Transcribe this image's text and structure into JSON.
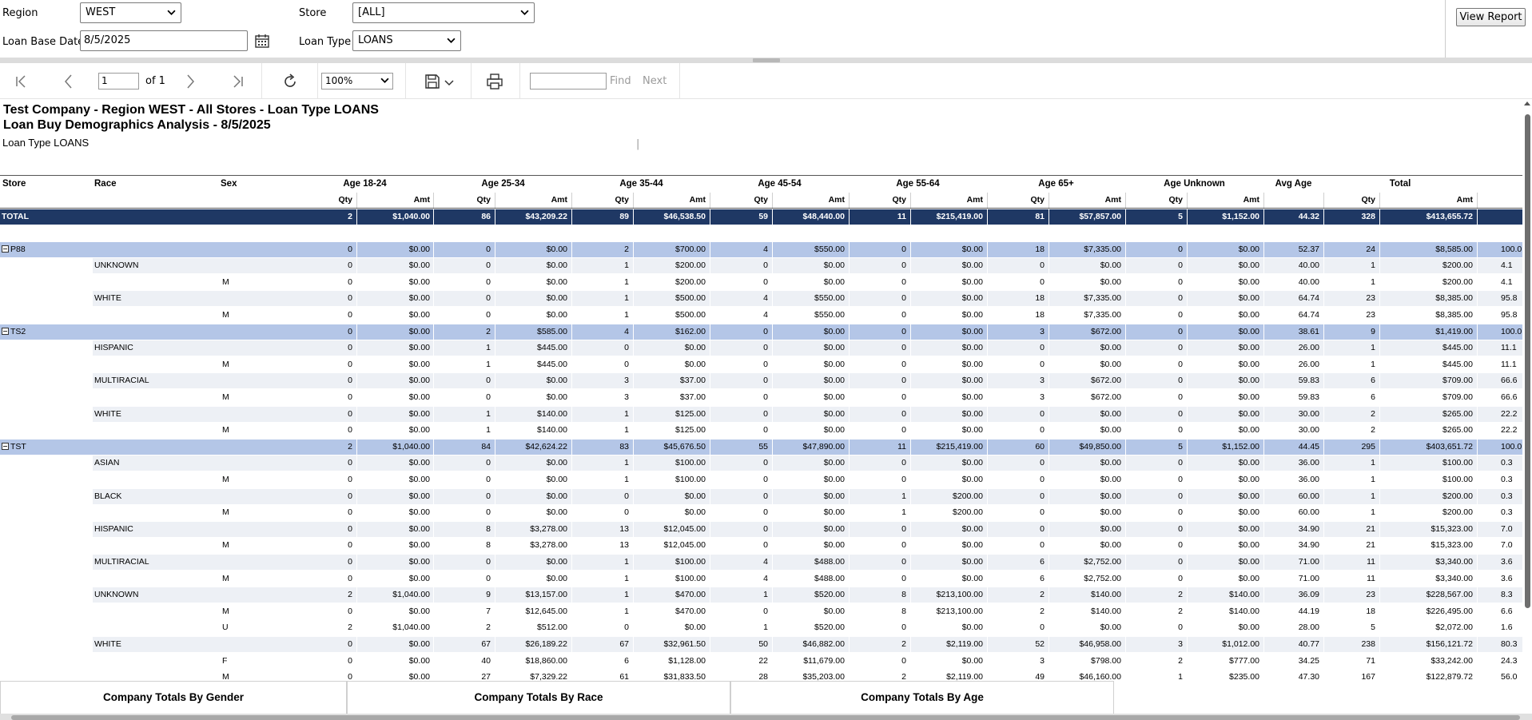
{
  "params": {
    "region_label": "Region",
    "region_value": "WEST",
    "store_label": "Store",
    "store_value": "[ALL]",
    "loan_base_date_label": "Loan Base Date",
    "loan_base_date_value": "8/5/2025",
    "loan_type_label": "Loan Type",
    "loan_type_value": "LOANS",
    "view_report_label": "View Report"
  },
  "toolbar": {
    "page_value": "1",
    "page_of": "of 1",
    "zoom_value": "100%",
    "find_placeholder": "",
    "find_label": "Find",
    "separator": "|",
    "next_label": "Next"
  },
  "report": {
    "title": "Test Company - Region WEST - All Stores - Loan Type LOANS",
    "subtitle": "Loan Buy Demographics Analysis - 8/5/2025",
    "loan_type_text": "Loan Type LOANS",
    "header1": [
      "Store",
      "Race",
      "Sex",
      "Age 18-24",
      "Age 25-34",
      "Age 35-44",
      "Age 45-54",
      "Age 55-64",
      "Age 65+",
      "Age Unknown",
      "Avg Age",
      "Total"
    ],
    "header2": [
      "Qty",
      "Amt",
      "Qty",
      "Amt",
      "Qty",
      "Amt",
      "Qty",
      "Amt",
      "Qty",
      "Amt",
      "Qty",
      "Amt",
      "Qty",
      "Amt",
      "Qty",
      "Amt"
    ],
    "rows": [
      {
        "kind": "total",
        "label": "TOTAL",
        "vals": [
          "2",
          "$1,040.00",
          "86",
          "$43,209.22",
          "89",
          "$46,538.50",
          "59",
          "$48,440.00",
          "11",
          "$215,419.00",
          "81",
          "$57,857.00",
          "5",
          "$1,152.00",
          "44.32",
          "328",
          "$413,655.72",
          ""
        ]
      },
      {
        "kind": "store",
        "label": "P88",
        "vals": [
          "0",
          "$0.00",
          "0",
          "$0.00",
          "2",
          "$700.00",
          "4",
          "$550.00",
          "0",
          "$0.00",
          "18",
          "$7,335.00",
          "0",
          "$0.00",
          "52.37",
          "24",
          "$8,585.00",
          "100.0"
        ]
      },
      {
        "kind": "race",
        "label": "UNKNOWN",
        "vals": [
          "0",
          "$0.00",
          "0",
          "$0.00",
          "1",
          "$200.00",
          "0",
          "$0.00",
          "0",
          "$0.00",
          "0",
          "$0.00",
          "0",
          "$0.00",
          "40.00",
          "1",
          "$200.00",
          "4.1"
        ]
      },
      {
        "kind": "sex",
        "label": "M",
        "vals": [
          "0",
          "$0.00",
          "0",
          "$0.00",
          "1",
          "$200.00",
          "0",
          "$0.00",
          "0",
          "$0.00",
          "0",
          "$0.00",
          "0",
          "$0.00",
          "40.00",
          "1",
          "$200.00",
          "4.1"
        ]
      },
      {
        "kind": "race",
        "label": "WHITE",
        "vals": [
          "0",
          "$0.00",
          "0",
          "$0.00",
          "1",
          "$500.00",
          "4",
          "$550.00",
          "0",
          "$0.00",
          "18",
          "$7,335.00",
          "0",
          "$0.00",
          "64.74",
          "23",
          "$8,385.00",
          "95.8"
        ]
      },
      {
        "kind": "sex",
        "label": "M",
        "vals": [
          "0",
          "$0.00",
          "0",
          "$0.00",
          "1",
          "$500.00",
          "4",
          "$550.00",
          "0",
          "$0.00",
          "18",
          "$7,335.00",
          "0",
          "$0.00",
          "64.74",
          "23",
          "$8,385.00",
          "95.8"
        ]
      },
      {
        "kind": "store",
        "label": "TS2",
        "vals": [
          "0",
          "$0.00",
          "2",
          "$585.00",
          "4",
          "$162.00",
          "0",
          "$0.00",
          "0",
          "$0.00",
          "3",
          "$672.00",
          "0",
          "$0.00",
          "38.61",
          "9",
          "$1,419.00",
          "100.0"
        ]
      },
      {
        "kind": "race",
        "label": "HISPANIC",
        "vals": [
          "0",
          "$0.00",
          "1",
          "$445.00",
          "0",
          "$0.00",
          "0",
          "$0.00",
          "0",
          "$0.00",
          "0",
          "$0.00",
          "0",
          "$0.00",
          "26.00",
          "1",
          "$445.00",
          "11.1"
        ]
      },
      {
        "kind": "sex",
        "label": "M",
        "vals": [
          "0",
          "$0.00",
          "1",
          "$445.00",
          "0",
          "$0.00",
          "0",
          "$0.00",
          "0",
          "$0.00",
          "0",
          "$0.00",
          "0",
          "$0.00",
          "26.00",
          "1",
          "$445.00",
          "11.1"
        ]
      },
      {
        "kind": "race",
        "label": "MULTIRACIAL",
        "vals": [
          "0",
          "$0.00",
          "0",
          "$0.00",
          "3",
          "$37.00",
          "0",
          "$0.00",
          "0",
          "$0.00",
          "3",
          "$672.00",
          "0",
          "$0.00",
          "59.83",
          "6",
          "$709.00",
          "66.6"
        ]
      },
      {
        "kind": "sex",
        "label": "M",
        "vals": [
          "0",
          "$0.00",
          "0",
          "$0.00",
          "3",
          "$37.00",
          "0",
          "$0.00",
          "0",
          "$0.00",
          "3",
          "$672.00",
          "0",
          "$0.00",
          "59.83",
          "6",
          "$709.00",
          "66.6"
        ]
      },
      {
        "kind": "race",
        "label": "WHITE",
        "vals": [
          "0",
          "$0.00",
          "1",
          "$140.00",
          "1",
          "$125.00",
          "0",
          "$0.00",
          "0",
          "$0.00",
          "0",
          "$0.00",
          "0",
          "$0.00",
          "30.00",
          "2",
          "$265.00",
          "22.2"
        ]
      },
      {
        "kind": "sex",
        "label": "M",
        "vals": [
          "0",
          "$0.00",
          "1",
          "$140.00",
          "1",
          "$125.00",
          "0",
          "$0.00",
          "0",
          "$0.00",
          "0",
          "$0.00",
          "0",
          "$0.00",
          "30.00",
          "2",
          "$265.00",
          "22.2"
        ]
      },
      {
        "kind": "store",
        "label": "TST",
        "vals": [
          "2",
          "$1,040.00",
          "84",
          "$42,624.22",
          "83",
          "$45,676.50",
          "55",
          "$47,890.00",
          "11",
          "$215,419.00",
          "60",
          "$49,850.00",
          "5",
          "$1,152.00",
          "44.45",
          "295",
          "$403,651.72",
          "100.0"
        ]
      },
      {
        "kind": "race",
        "label": "ASIAN",
        "vals": [
          "0",
          "$0.00",
          "0",
          "$0.00",
          "1",
          "$100.00",
          "0",
          "$0.00",
          "0",
          "$0.00",
          "0",
          "$0.00",
          "0",
          "$0.00",
          "36.00",
          "1",
          "$100.00",
          "0.3"
        ]
      },
      {
        "kind": "sex",
        "label": "M",
        "vals": [
          "0",
          "$0.00",
          "0",
          "$0.00",
          "1",
          "$100.00",
          "0",
          "$0.00",
          "0",
          "$0.00",
          "0",
          "$0.00",
          "0",
          "$0.00",
          "36.00",
          "1",
          "$100.00",
          "0.3"
        ]
      },
      {
        "kind": "race",
        "label": "BLACK",
        "vals": [
          "0",
          "$0.00",
          "0",
          "$0.00",
          "0",
          "$0.00",
          "0",
          "$0.00",
          "1",
          "$200.00",
          "0",
          "$0.00",
          "0",
          "$0.00",
          "60.00",
          "1",
          "$200.00",
          "0.3"
        ]
      },
      {
        "kind": "sex",
        "label": "M",
        "vals": [
          "0",
          "$0.00",
          "0",
          "$0.00",
          "0",
          "$0.00",
          "0",
          "$0.00",
          "1",
          "$200.00",
          "0",
          "$0.00",
          "0",
          "$0.00",
          "60.00",
          "1",
          "$200.00",
          "0.3"
        ]
      },
      {
        "kind": "race",
        "label": "HISPANIC",
        "vals": [
          "0",
          "$0.00",
          "8",
          "$3,278.00",
          "13",
          "$12,045.00",
          "0",
          "$0.00",
          "0",
          "$0.00",
          "0",
          "$0.00",
          "0",
          "$0.00",
          "34.90",
          "21",
          "$15,323.00",
          "7.0"
        ]
      },
      {
        "kind": "sex",
        "label": "M",
        "vals": [
          "0",
          "$0.00",
          "8",
          "$3,278.00",
          "13",
          "$12,045.00",
          "0",
          "$0.00",
          "0",
          "$0.00",
          "0",
          "$0.00",
          "0",
          "$0.00",
          "34.90",
          "21",
          "$15,323.00",
          "7.0"
        ]
      },
      {
        "kind": "race",
        "label": "MULTIRACIAL",
        "vals": [
          "0",
          "$0.00",
          "0",
          "$0.00",
          "1",
          "$100.00",
          "4",
          "$488.00",
          "0",
          "$0.00",
          "6",
          "$2,752.00",
          "0",
          "$0.00",
          "71.00",
          "11",
          "$3,340.00",
          "3.6"
        ]
      },
      {
        "kind": "sex",
        "label": "M",
        "vals": [
          "0",
          "$0.00",
          "0",
          "$0.00",
          "1",
          "$100.00",
          "4",
          "$488.00",
          "0",
          "$0.00",
          "6",
          "$2,752.00",
          "0",
          "$0.00",
          "71.00",
          "11",
          "$3,340.00",
          "3.6"
        ]
      },
      {
        "kind": "race",
        "label": "UNKNOWN",
        "vals": [
          "2",
          "$1,040.00",
          "9",
          "$13,157.00",
          "1",
          "$470.00",
          "1",
          "$520.00",
          "8",
          "$213,100.00",
          "2",
          "$140.00",
          "2",
          "$140.00",
          "36.09",
          "23",
          "$228,567.00",
          "8.3"
        ]
      },
      {
        "kind": "sex",
        "label": "M",
        "vals": [
          "0",
          "$0.00",
          "7",
          "$12,645.00",
          "1",
          "$470.00",
          "0",
          "$0.00",
          "8",
          "$213,100.00",
          "2",
          "$140.00",
          "2",
          "$140.00",
          "44.19",
          "18",
          "$226,495.00",
          "6.6"
        ]
      },
      {
        "kind": "sex",
        "label": "U",
        "vals": [
          "2",
          "$1,040.00",
          "2",
          "$512.00",
          "0",
          "$0.00",
          "1",
          "$520.00",
          "0",
          "$0.00",
          "0",
          "$0.00",
          "0",
          "$0.00",
          "28.00",
          "5",
          "$2,072.00",
          "1.6"
        ]
      },
      {
        "kind": "race",
        "label": "WHITE",
        "vals": [
          "0",
          "$0.00",
          "67",
          "$26,189.22",
          "67",
          "$32,961.50",
          "50",
          "$46,882.00",
          "2",
          "$2,119.00",
          "52",
          "$46,958.00",
          "3",
          "$1,012.00",
          "40.77",
          "238",
          "$156,121.72",
          "80.3"
        ]
      },
      {
        "kind": "sex",
        "label": "F",
        "vals": [
          "0",
          "$0.00",
          "40",
          "$18,860.00",
          "6",
          "$1,128.00",
          "22",
          "$11,679.00",
          "0",
          "$0.00",
          "3",
          "$798.00",
          "2",
          "$777.00",
          "34.25",
          "71",
          "$33,242.00",
          "24.3"
        ]
      },
      {
        "kind": "sex",
        "label": "M",
        "vals": [
          "0",
          "$0.00",
          "27",
          "$7,329.22",
          "61",
          "$31,833.50",
          "28",
          "$35,203.00",
          "2",
          "$2,119.00",
          "49",
          "$46,160.00",
          "1",
          "$235.00",
          "47.30",
          "167",
          "$122,879.72",
          "56.0"
        ]
      }
    ]
  },
  "tabs": [
    "Company Totals By Gender",
    "Company Totals By Race",
    "Company Totals By Age"
  ]
}
